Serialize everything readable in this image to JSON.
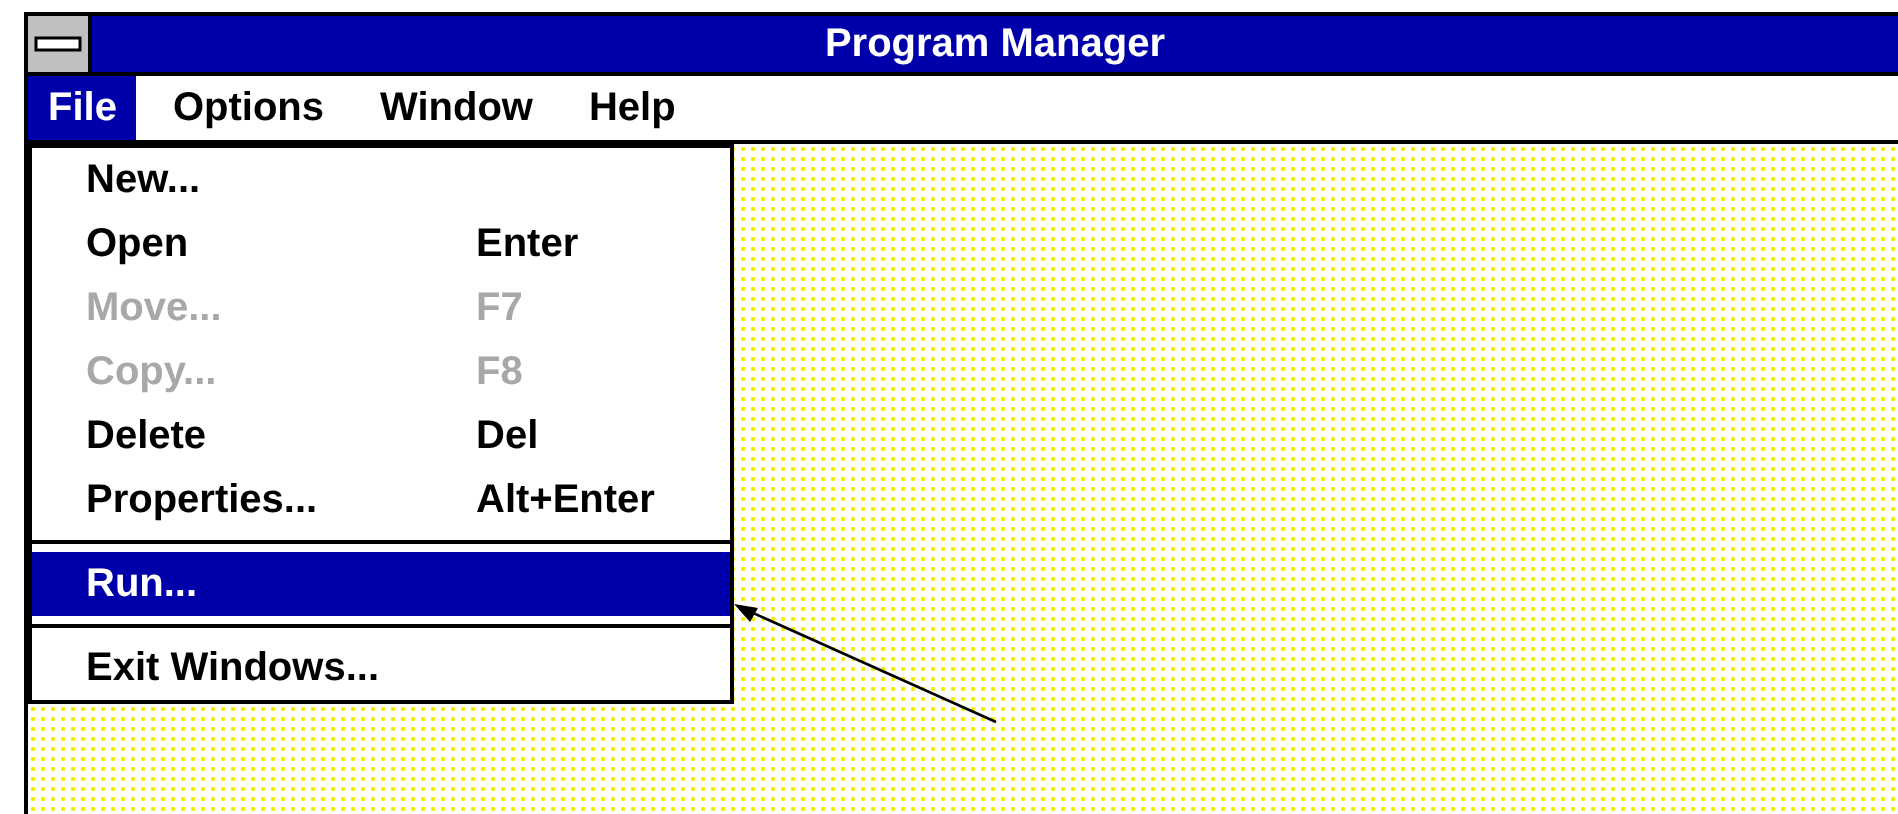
{
  "window": {
    "title": "Program Manager"
  },
  "menu_bar": [
    {
      "label": "File",
      "selected": true
    },
    {
      "label": "Options",
      "selected": false
    },
    {
      "label": "Window",
      "selected": false
    },
    {
      "label": "Help",
      "selected": false
    }
  ],
  "file_menu": [
    {
      "kind": "item",
      "label": "New...",
      "disabled": false,
      "selected": false
    },
    {
      "kind": "item",
      "label": "Open",
      "shortcut": "Enter",
      "disabled": false,
      "selected": false
    },
    {
      "kind": "item",
      "label": "Move...",
      "shortcut": "F7",
      "disabled": true,
      "selected": false
    },
    {
      "kind": "item",
      "label": "Copy...",
      "shortcut": "F8",
      "disabled": true,
      "selected": false
    },
    {
      "kind": "item",
      "label": "Delete",
      "shortcut": "Del",
      "disabled": false,
      "selected": false
    },
    {
      "kind": "item",
      "label": "Properties...",
      "shortcut": "Alt+Enter",
      "disabled": false,
      "selected": false
    },
    {
      "kind": "separator"
    },
    {
      "kind": "item",
      "label": "Run...",
      "disabled": false,
      "selected": true
    },
    {
      "kind": "separator"
    },
    {
      "kind": "item",
      "label": "Exit Windows...",
      "disabled": false,
      "selected": false
    }
  ]
}
